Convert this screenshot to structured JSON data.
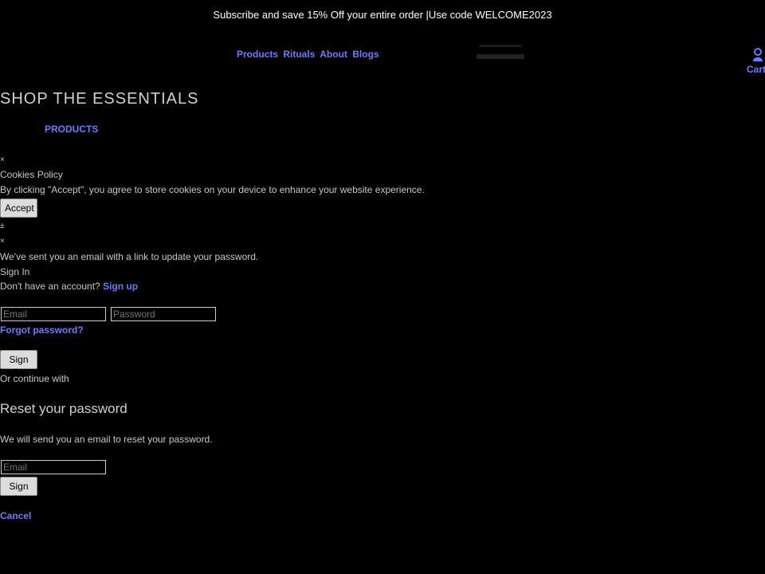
{
  "banner": {
    "text": "Subscribe and save 15% Off your entire order |Use code WELCOME2023"
  },
  "nav": {
    "items": [
      "Products",
      "Rituals",
      "About",
      "Blogs"
    ]
  },
  "header": {
    "cart_label": "Cart",
    "user_icon": "user-icon"
  },
  "hero": {
    "heading": "SHOP THE ESSENTIALS",
    "products_link": "PRODUCTS"
  },
  "cookies": {
    "close": "×",
    "title": "Cookies Policy",
    "text": "By clicking \"Accept\", you agree to store cookies on your device to enhance your website experience.",
    "accept_label": "Accept"
  },
  "signin": {
    "marker_a": "±",
    "close": "×",
    "sent_msg": "We've sent you an email with a link to update your password.",
    "title": "Sign In",
    "no_account": "Don't have an account?",
    "signup_link": "Sign up",
    "email_placeholder": "Email",
    "password_placeholder": "Password",
    "forgot_link": "Forgot password?",
    "signin_label": "Sign In",
    "continue_with": "Or continue with"
  },
  "reset": {
    "title": "Reset your password",
    "text": "We will send you an email to reset your password.",
    "email_placeholder": "Email",
    "submit_label": "Sign In",
    "cancel_link": "Cancel"
  },
  "colors": {
    "accent": "#6b7bff",
    "background": "#000000",
    "banner_text": "#ffffff"
  }
}
